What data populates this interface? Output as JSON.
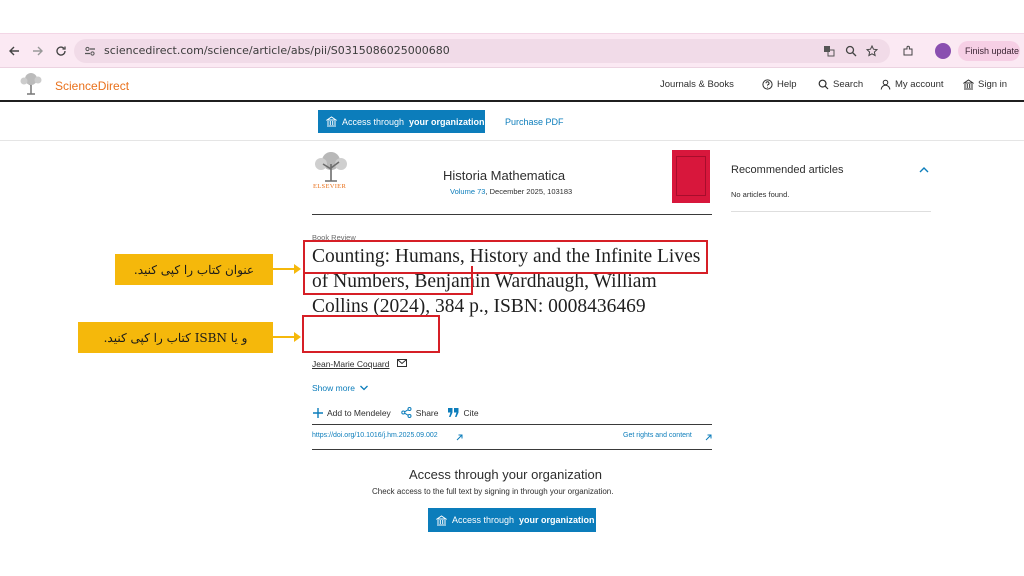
{
  "browser": {
    "url": "sciencedirect.com/science/article/abs/pii/S0315086025000680",
    "finish_update": "Finish update"
  },
  "site": {
    "brand": "ScienceDirect",
    "nav": {
      "journals": "Journals & Books",
      "help": "Help",
      "search": "Search",
      "account": "My account",
      "signin": "Sign in"
    }
  },
  "access_bar": {
    "button_prefix": "Access through",
    "button_strong": "your organization",
    "purchase": "Purchase PDF"
  },
  "journal": {
    "publisher": "ELSEVIER",
    "title": "Historia Mathematica",
    "volume": "Volume 73",
    "meta_rest": ", December 2025, 103183"
  },
  "recommended": {
    "title": "Recommended articles",
    "empty": "No articles found."
  },
  "article": {
    "category": "Book Review",
    "title": "Counting: Humans, History and the Infinite Lives of Numbers, Benjamin Wardhaugh, William Collins (2024), 384 p., ISBN: 0008436469",
    "author": "Jean-Marie Coquard",
    "show_more": "Show more",
    "actions": {
      "mendeley": "Add to Mendeley",
      "share": "Share",
      "cite": "Cite"
    },
    "doi": "https://doi.org/10.1016/j.hm.2025.09.002",
    "rights": "Get rights and content"
  },
  "access_section": {
    "heading": "Access through your organization",
    "sub": "Check access to the full text by signing in through your organization.",
    "button_prefix": "Access through",
    "button_strong": "your organization"
  },
  "annotations": {
    "copy_title": "عنوان کتاب را کپی کنید.",
    "copy_isbn": "و یا ISBN کتاب را کپی کنید."
  },
  "colors": {
    "accent_blue": "#0c7dbb",
    "brand_orange": "#e9711c",
    "highlight_red": "#d61f26",
    "callout_yellow": "#f5b80b"
  }
}
